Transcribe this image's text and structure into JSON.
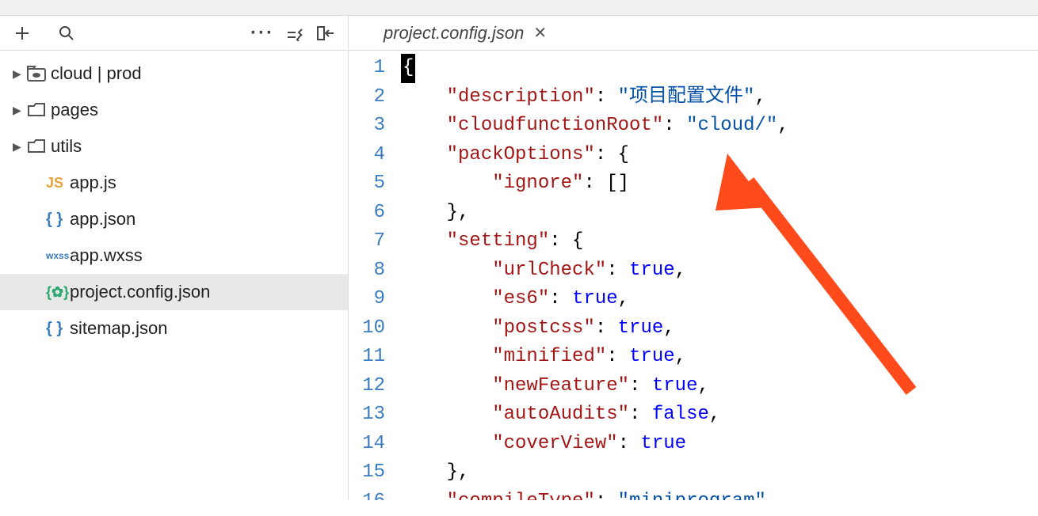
{
  "toolbar": {
    "plus": "+",
    "search": "🔍",
    "more": "···"
  },
  "tree": [
    {
      "kind": "folder-cloud",
      "label": "cloud | prod",
      "chevron": true,
      "indent": false,
      "selected": false
    },
    {
      "kind": "folder",
      "label": "pages",
      "chevron": true,
      "indent": false,
      "selected": false
    },
    {
      "kind": "folder",
      "label": "utils",
      "chevron": true,
      "indent": false,
      "selected": false
    },
    {
      "kind": "js",
      "label": "app.js",
      "chevron": false,
      "indent": true,
      "selected": false
    },
    {
      "kind": "json",
      "label": "app.json",
      "chevron": false,
      "indent": true,
      "selected": false
    },
    {
      "kind": "wxss",
      "label": "app.wxss",
      "chevron": false,
      "indent": true,
      "selected": false
    },
    {
      "kind": "config",
      "label": "project.config.json",
      "chevron": false,
      "indent": true,
      "selected": true
    },
    {
      "kind": "json",
      "label": "sitemap.json",
      "chevron": false,
      "indent": true,
      "selected": false
    }
  ],
  "tab": {
    "title": "project.config.json"
  },
  "code": {
    "lines": [
      [
        {
          "t": "cursor",
          "v": "{"
        }
      ],
      [
        {
          "t": "indent",
          "v": 4
        },
        {
          "t": "key",
          "v": "\"description\""
        },
        {
          "t": "p",
          "v": ": "
        },
        {
          "t": "str",
          "v": "\"项目配置文件\""
        },
        {
          "t": "p",
          "v": ","
        }
      ],
      [
        {
          "t": "indent",
          "v": 4
        },
        {
          "t": "key",
          "v": "\"cloudfunctionRoot\""
        },
        {
          "t": "p",
          "v": ": "
        },
        {
          "t": "str",
          "v": "\"cloud/\""
        },
        {
          "t": "p",
          "v": ","
        }
      ],
      [
        {
          "t": "indent",
          "v": 4
        },
        {
          "t": "key",
          "v": "\"packOptions\""
        },
        {
          "t": "p",
          "v": ": {"
        }
      ],
      [
        {
          "t": "indent",
          "v": 8
        },
        {
          "t": "key",
          "v": "\"ignore\""
        },
        {
          "t": "p",
          "v": ": []"
        }
      ],
      [
        {
          "t": "indent",
          "v": 4
        },
        {
          "t": "p",
          "v": "},"
        }
      ],
      [
        {
          "t": "indent",
          "v": 4
        },
        {
          "t": "key",
          "v": "\"setting\""
        },
        {
          "t": "p",
          "v": ": {"
        }
      ],
      [
        {
          "t": "indent",
          "v": 8
        },
        {
          "t": "key",
          "v": "\"urlCheck\""
        },
        {
          "t": "p",
          "v": ": "
        },
        {
          "t": "bool",
          "v": "true"
        },
        {
          "t": "p",
          "v": ","
        }
      ],
      [
        {
          "t": "indent",
          "v": 8
        },
        {
          "t": "key",
          "v": "\"es6\""
        },
        {
          "t": "p",
          "v": ": "
        },
        {
          "t": "bool",
          "v": "true"
        },
        {
          "t": "p",
          "v": ","
        }
      ],
      [
        {
          "t": "indent",
          "v": 8
        },
        {
          "t": "key",
          "v": "\"postcss\""
        },
        {
          "t": "p",
          "v": ": "
        },
        {
          "t": "bool",
          "v": "true"
        },
        {
          "t": "p",
          "v": ","
        }
      ],
      [
        {
          "t": "indent",
          "v": 8
        },
        {
          "t": "key",
          "v": "\"minified\""
        },
        {
          "t": "p",
          "v": ": "
        },
        {
          "t": "bool",
          "v": "true"
        },
        {
          "t": "p",
          "v": ","
        }
      ],
      [
        {
          "t": "indent",
          "v": 8
        },
        {
          "t": "key",
          "v": "\"newFeature\""
        },
        {
          "t": "p",
          "v": ": "
        },
        {
          "t": "bool",
          "v": "true"
        },
        {
          "t": "p",
          "v": ","
        }
      ],
      [
        {
          "t": "indent",
          "v": 8
        },
        {
          "t": "key",
          "v": "\"autoAudits\""
        },
        {
          "t": "p",
          "v": ": "
        },
        {
          "t": "bool",
          "v": "false"
        },
        {
          "t": "p",
          "v": ","
        }
      ],
      [
        {
          "t": "indent",
          "v": 8
        },
        {
          "t": "key",
          "v": "\"coverView\""
        },
        {
          "t": "p",
          "v": ": "
        },
        {
          "t": "bool",
          "v": "true"
        }
      ],
      [
        {
          "t": "indent",
          "v": 4
        },
        {
          "t": "p",
          "v": "},"
        }
      ],
      [
        {
          "t": "indent",
          "v": 4
        },
        {
          "t": "key",
          "v": "\"compileType\""
        },
        {
          "t": "p",
          "v": ": "
        },
        {
          "t": "str",
          "v": "\"miniprogram\""
        },
        {
          "t": "p",
          "v": "."
        }
      ]
    ]
  },
  "icons": {
    "js_label": "JS",
    "wxss_label": "wxss",
    "json_label": "{ }",
    "config_label": "{✿}"
  }
}
